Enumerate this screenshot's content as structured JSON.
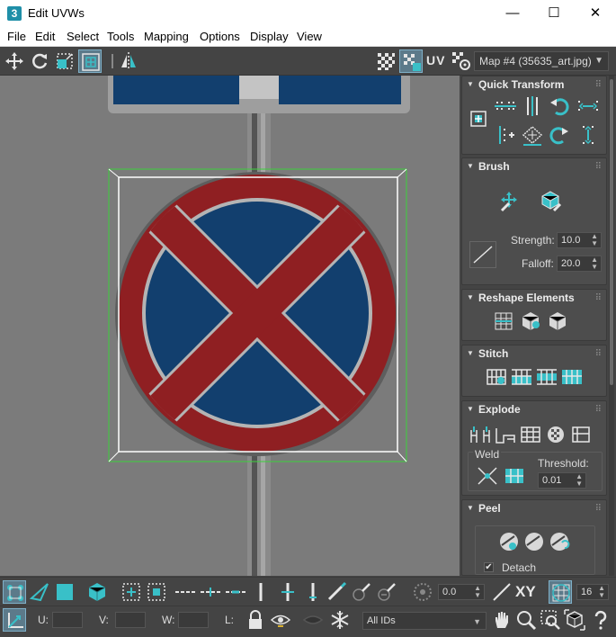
{
  "window": {
    "app_icon_text": "3",
    "title": "Edit UVWs",
    "minimize": "—",
    "maximize": "☐",
    "close": "✕"
  },
  "menu": {
    "items": [
      "File",
      "Edit",
      "Select",
      "Tools",
      "Mapping",
      "Options",
      "Display",
      "View"
    ]
  },
  "toolbar": {
    "uv_label": "UV",
    "map_selected": "Map #4 (35635_art.jpg)"
  },
  "panel": {
    "quick_transform": {
      "title": "Quick Transform"
    },
    "brush": {
      "title": "Brush",
      "strength_label": "Strength:",
      "strength_value": "10.0",
      "falloff_label": "Falloff:",
      "falloff_value": "20.0"
    },
    "reshape": {
      "title": "Reshape Elements"
    },
    "stitch": {
      "title": "Stitch"
    },
    "explode": {
      "title": "Explode",
      "weld_label": "Weld",
      "threshold_label": "Threshold:",
      "threshold_value": "0.01"
    },
    "peel": {
      "title": "Peel",
      "detach_label": "Detach",
      "detach_checked": true
    }
  },
  "bottom": {
    "angle_value": "0.0",
    "xy_label": "XY",
    "grid_value": "16",
    "u_label": "U:",
    "v_label": "V:",
    "w_label": "W:",
    "l_label": "L:",
    "ids_selected": "All IDs"
  },
  "colors": {
    "accent_teal": "#39c0c8",
    "sign_red": "#9a2222",
    "sign_blue": "#123f6e",
    "viewport_gray": "#7a7a7a"
  }
}
